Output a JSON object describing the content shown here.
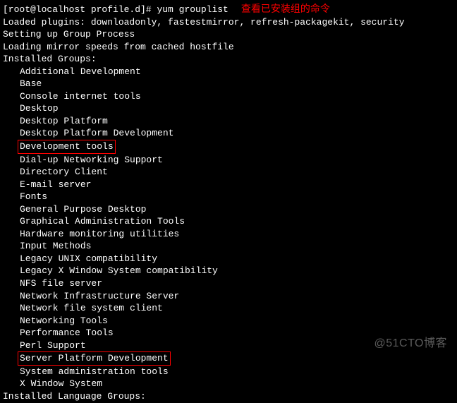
{
  "prompt": "[root@localhost profile.d]# ",
  "command": "yum grouplist",
  "annotation": "查看已安装组的命令",
  "output_lines": [
    "Loaded plugins: downloadonly, fastestmirror, refresh-packagekit, security",
    "Setting up Group Process",
    "Loading mirror speeds from cached hostfile",
    "Installed Groups:"
  ],
  "groups": [
    {
      "name": "Additional Development",
      "highlight": false
    },
    {
      "name": "Base",
      "highlight": false
    },
    {
      "name": "Console internet tools",
      "highlight": false
    },
    {
      "name": "Desktop",
      "highlight": false
    },
    {
      "name": "Desktop Platform",
      "highlight": false
    },
    {
      "name": "Desktop Platform Development",
      "highlight": false
    },
    {
      "name": "Development tools",
      "highlight": true
    },
    {
      "name": "Dial-up Networking Support",
      "highlight": false
    },
    {
      "name": "Directory Client",
      "highlight": false
    },
    {
      "name": "E-mail server",
      "highlight": false
    },
    {
      "name": "Fonts",
      "highlight": false
    },
    {
      "name": "General Purpose Desktop",
      "highlight": false
    },
    {
      "name": "Graphical Administration Tools",
      "highlight": false
    },
    {
      "name": "Hardware monitoring utilities",
      "highlight": false
    },
    {
      "name": "Input Methods",
      "highlight": false
    },
    {
      "name": "Legacy UNIX compatibility",
      "highlight": false
    },
    {
      "name": "Legacy X Window System compatibility",
      "highlight": false
    },
    {
      "name": "NFS file server",
      "highlight": false
    },
    {
      "name": "Network Infrastructure Server",
      "highlight": false
    },
    {
      "name": "Network file system client",
      "highlight": false
    },
    {
      "name": "Networking Tools",
      "highlight": false
    },
    {
      "name": "Performance Tools",
      "highlight": false
    },
    {
      "name": "Perl Support",
      "highlight": false
    },
    {
      "name": "Server Platform Development",
      "highlight": true
    },
    {
      "name": "System administration tools",
      "highlight": false
    },
    {
      "name": "X Window System",
      "highlight": false
    }
  ],
  "footer_line": "Installed Language Groups:",
  "watermark": "@51CTO博客"
}
